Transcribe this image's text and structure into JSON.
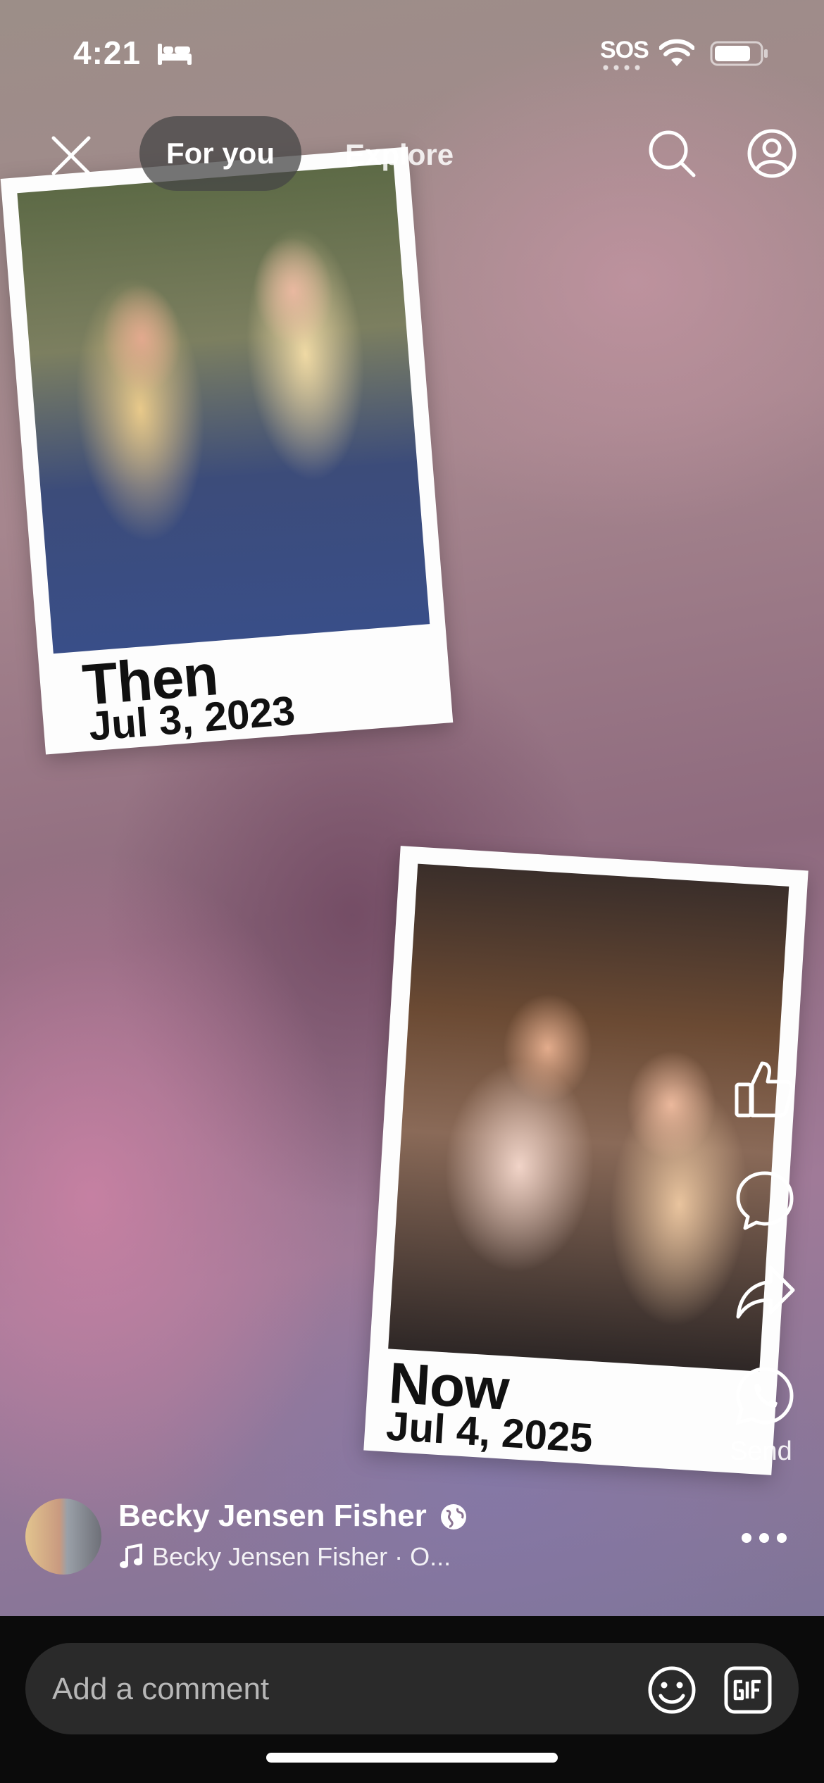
{
  "status_bar": {
    "time": "4:21",
    "sos": "SOS"
  },
  "nav": {
    "tab_for_you": "For you",
    "tab_explore": "Explore"
  },
  "story": {
    "cards": [
      {
        "title": "Then",
        "date": "Jul 3, 2023"
      },
      {
        "title": "Now",
        "date": "Jul 4, 2025"
      }
    ]
  },
  "actions": {
    "send_label": "Send"
  },
  "author": {
    "name": "Becky Jensen Fisher",
    "audio": "Becky Jensen Fisher · O..."
  },
  "comment": {
    "placeholder": "Add a comment"
  },
  "icons": [
    "bed-icon",
    "wifi-icon",
    "battery-icon",
    "close-icon",
    "search-icon",
    "profile-icon",
    "like-icon",
    "comment-icon",
    "share-icon",
    "whatsapp-icon",
    "globe-icon",
    "music-icon",
    "more-icon",
    "emoji-icon",
    "gif-icon"
  ]
}
